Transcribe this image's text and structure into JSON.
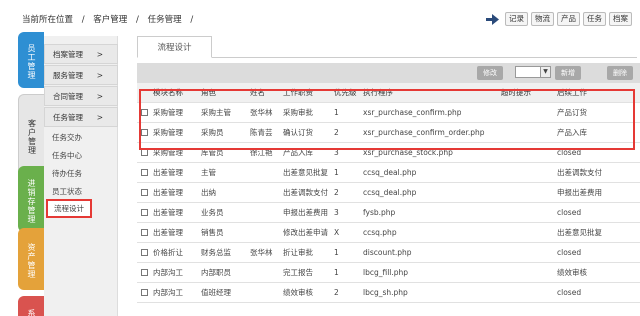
{
  "breadcrumb": {
    "items": [
      "当前所在位置",
      "客户管理",
      "任务管理"
    ],
    "sep": "/"
  },
  "quick_links": [
    "记录",
    "物流",
    "产品",
    "任务",
    "档案"
  ],
  "vtabs": [
    {
      "label": "员工管理",
      "color": "#2e8fd3"
    },
    {
      "label": "客户管理",
      "color": "#e6e6e6",
      "text_color": "#333"
    },
    {
      "label": "进销存管理",
      "color": "#6ab04c"
    },
    {
      "label": "资产管理",
      "color": "#e4a23a"
    },
    {
      "label": "系",
      "color": "#d9534f"
    }
  ],
  "sidebar": {
    "menus": [
      "档案管理",
      "服务管理",
      "合同管理",
      "任务管理"
    ],
    "chevron": ">",
    "subitems": [
      "任务交办",
      "任务中心",
      "待办任务",
      "员工状态",
      "流程设计"
    ]
  },
  "page": {
    "tab_title": "流程设计"
  },
  "toolbar": {
    "modify": "修改",
    "new": "新增",
    "delete": "删除",
    "select_arrow": "▼"
  },
  "table": {
    "columns": [
      "模块名称",
      "角色",
      "姓名",
      "工作职责",
      "优先级",
      "执行程序",
      "超时提示",
      "后续工作"
    ],
    "rows": [
      [
        "采购管理",
        "采购主管",
        "张华林",
        "采购审批",
        "1",
        "xsr_purchase_confirm.php",
        "",
        "产品订货"
      ],
      [
        "采购管理",
        "采购员",
        "陈青芸",
        "确认订货",
        "2",
        "xsr_purchase_confirm_order.php",
        "",
        "产品入库"
      ],
      [
        "采购管理",
        "库管员",
        "徐江艳",
        "产品入库",
        "3",
        "xsr_purchase_stock.php",
        "",
        "closed"
      ],
      [
        "出差管理",
        "主管",
        "",
        "出差意见批复",
        "1",
        "ccsq_deal.php",
        "",
        "出差调款支付"
      ],
      [
        "出差管理",
        "出纳",
        "",
        "出差调款支付",
        "2",
        "ccsq_deal.php",
        "",
        "申报出差费用"
      ],
      [
        "出差管理",
        "业务员",
        "",
        "申报出差费用",
        "3",
        "fysb.php",
        "",
        "closed"
      ],
      [
        "出差管理",
        "销售员",
        "",
        "修改出差申请",
        "X",
        "ccsq.php",
        "",
        "出差意见批复"
      ],
      [
        "价格折让",
        "财务总监",
        "张华林",
        "折让审批",
        "1",
        "discount.php",
        "",
        "closed"
      ],
      [
        "内部沟工",
        "内部职员",
        "",
        "完工报告",
        "1",
        "lbcg_fill.php",
        "",
        "绩效审核"
      ],
      [
        "内部沟工",
        "值班经理",
        "",
        "绩效审核",
        "2",
        "lbcg_sh.php",
        "",
        "closed"
      ]
    ]
  }
}
